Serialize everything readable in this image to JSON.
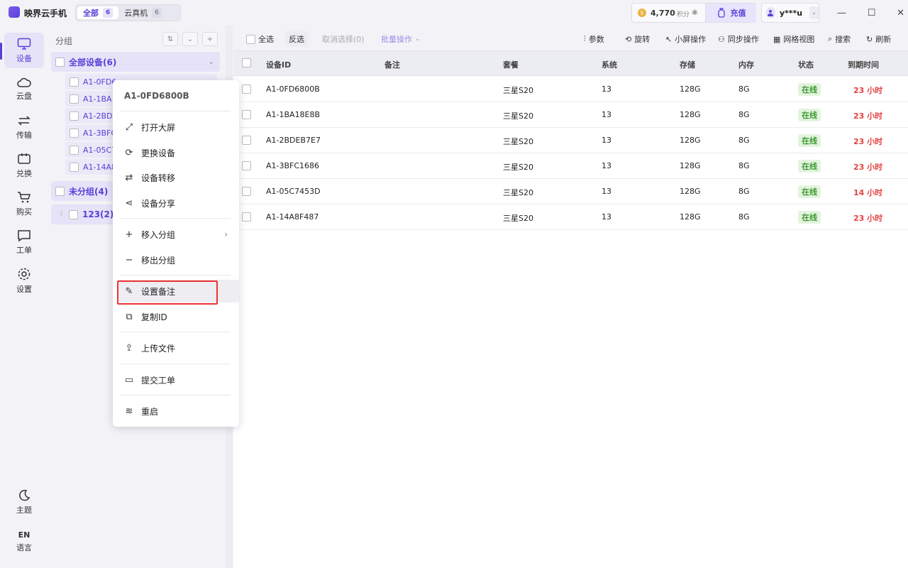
{
  "app": {
    "title": "映界云手机"
  },
  "top_tabs": [
    {
      "label": "全部",
      "count": "6"
    },
    {
      "label": "云真机",
      "count": "6"
    }
  ],
  "points": {
    "value": "4,770",
    "unit": "积分",
    "recharge": "充值"
  },
  "user": {
    "name": "y***u"
  },
  "rail": [
    {
      "label": "设备",
      "icon": "monitor-icon"
    },
    {
      "label": "云盘",
      "icon": "cloud-icon"
    },
    {
      "label": "传输",
      "icon": "transfer-icon"
    },
    {
      "label": "兑换",
      "icon": "ticket-icon"
    },
    {
      "label": "购买",
      "icon": "cart-icon"
    },
    {
      "label": "工单",
      "icon": "message-icon"
    },
    {
      "label": "设置",
      "icon": "gear-icon"
    }
  ],
  "rail_bottom": {
    "theme": "主题",
    "lang_code": "EN",
    "lang": "语言"
  },
  "groups": {
    "title": "分组",
    "all": "全部设备(6)",
    "devices": [
      "A1-0FD6",
      "A1-1BA1",
      "A1-2BDE",
      "A1-3BFC",
      "A1-05C7",
      "A1-14A8"
    ],
    "ungrouped": "未分组(4)",
    "custom": "123(2)"
  },
  "toolbar": {
    "select_all": "全选",
    "invert": "反选",
    "cancel_select": "取消选择(0)",
    "batch": "批量操作",
    "params": "参数",
    "rotate": "旋转",
    "small_screen": "小屏操作",
    "sync": "同步操作",
    "grid": "网格视图",
    "search": "搜索",
    "refresh": "刷新"
  },
  "table": {
    "headers": [
      "设备ID",
      "备注",
      "套餐",
      "系统",
      "存储",
      "内存",
      "状态",
      "到期时间"
    ],
    "rows": [
      {
        "id": "A1-0FD6800B",
        "note": "",
        "plan": "三星S20",
        "os": "13",
        "storage": "128G",
        "ram": "8G",
        "status": "在线",
        "expire": "23 小时"
      },
      {
        "id": "A1-1BA18E8B",
        "note": "",
        "plan": "三星S20",
        "os": "13",
        "storage": "128G",
        "ram": "8G",
        "status": "在线",
        "expire": "23 小时"
      },
      {
        "id": "A1-2BDEB7E7",
        "note": "",
        "plan": "三星S20",
        "os": "13",
        "storage": "128G",
        "ram": "8G",
        "status": "在线",
        "expire": "23 小时"
      },
      {
        "id": "A1-3BFC1686",
        "note": "",
        "plan": "三星S20",
        "os": "13",
        "storage": "128G",
        "ram": "8G",
        "status": "在线",
        "expire": "23 小时"
      },
      {
        "id": "A1-05C7453D",
        "note": "",
        "plan": "三星S20",
        "os": "13",
        "storage": "128G",
        "ram": "8G",
        "status": "在线",
        "expire": "14 小时"
      },
      {
        "id": "A1-14A8F487",
        "note": "",
        "plan": "三星S20",
        "os": "13",
        "storage": "128G",
        "ram": "8G",
        "status": "在线",
        "expire": "23 小时"
      }
    ]
  },
  "context_menu": {
    "title": "A1-0FD6800B",
    "items": [
      {
        "label": "打开大屏",
        "icon": "expand-icon"
      },
      {
        "label": "更换设备",
        "icon": "refresh-icon"
      },
      {
        "label": "设备转移",
        "icon": "transfer-icon"
      },
      {
        "label": "设备分享",
        "icon": "share-icon"
      },
      {
        "label": "移入分组",
        "icon": "plus-icon"
      },
      {
        "label": "移出分组",
        "icon": "minus-icon"
      },
      {
        "label": "设置备注",
        "icon": "edit-icon"
      },
      {
        "label": "复制ID",
        "icon": "copy-icon"
      },
      {
        "label": "上传文件",
        "icon": "upload-icon"
      },
      {
        "label": "提交工单",
        "icon": "message-icon"
      },
      {
        "label": "重启",
        "icon": "layers-icon"
      }
    ]
  },
  "colors": {
    "accent": "#5b3fd8",
    "online": "#3c9a30",
    "expire": "#e54141",
    "highlight_border": "#ee3333"
  }
}
